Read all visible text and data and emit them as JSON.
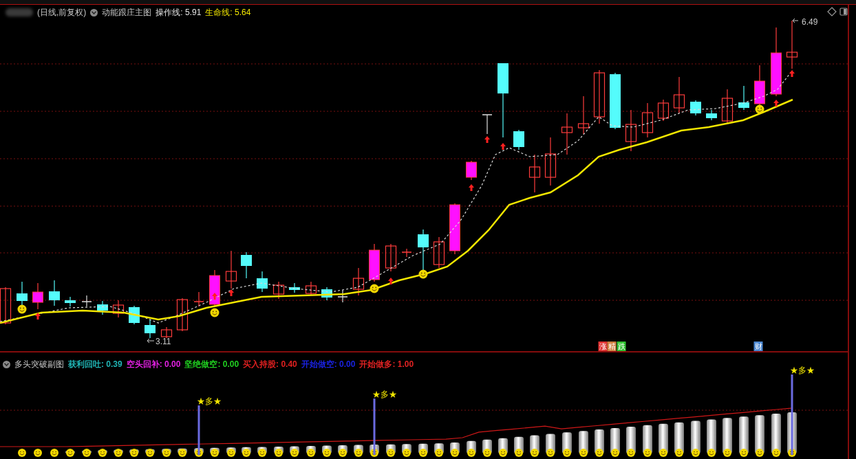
{
  "header": {
    "period": "(日线,前复权)",
    "indicator": "动能跟庄主图",
    "lines": [
      {
        "label": "操作线:",
        "value": "5.91",
        "color": "#e6e6e6"
      },
      {
        "label": "生命线:",
        "value": "5.64",
        "color": "#f2e600"
      }
    ]
  },
  "main_chart": {
    "high_label": "6.49",
    "low_label": "3.11",
    "signal_tags": [
      {
        "text": "涨",
        "color": "#e03030"
      },
      {
        "text": "精",
        "color": "#d08040"
      },
      {
        "text": "跌",
        "color": "#30c030"
      },
      {
        "text": "财",
        "color": "#4a86d0"
      }
    ]
  },
  "sub_chart": {
    "title": "多头突破副图",
    "legend": [
      {
        "label": "获利回吐:",
        "value": "0.39",
        "color": "#20b4b4"
      },
      {
        "label": "空头回补:",
        "value": "0.00",
        "color": "#e020e0"
      },
      {
        "label": "坚绝做空:",
        "value": "0.00",
        "color": "#20d020"
      },
      {
        "label": "买入持股:",
        "value": "0.40",
        "color": "#e02020"
      },
      {
        "label": "开始做空:",
        "value": "0.00",
        "color": "#1a22e0"
      },
      {
        "label": "开始做多:",
        "value": "1.00",
        "color": "#e02222"
      }
    ],
    "signal_labels": [
      "★多★",
      "★多★",
      "★多★"
    ]
  }
}
